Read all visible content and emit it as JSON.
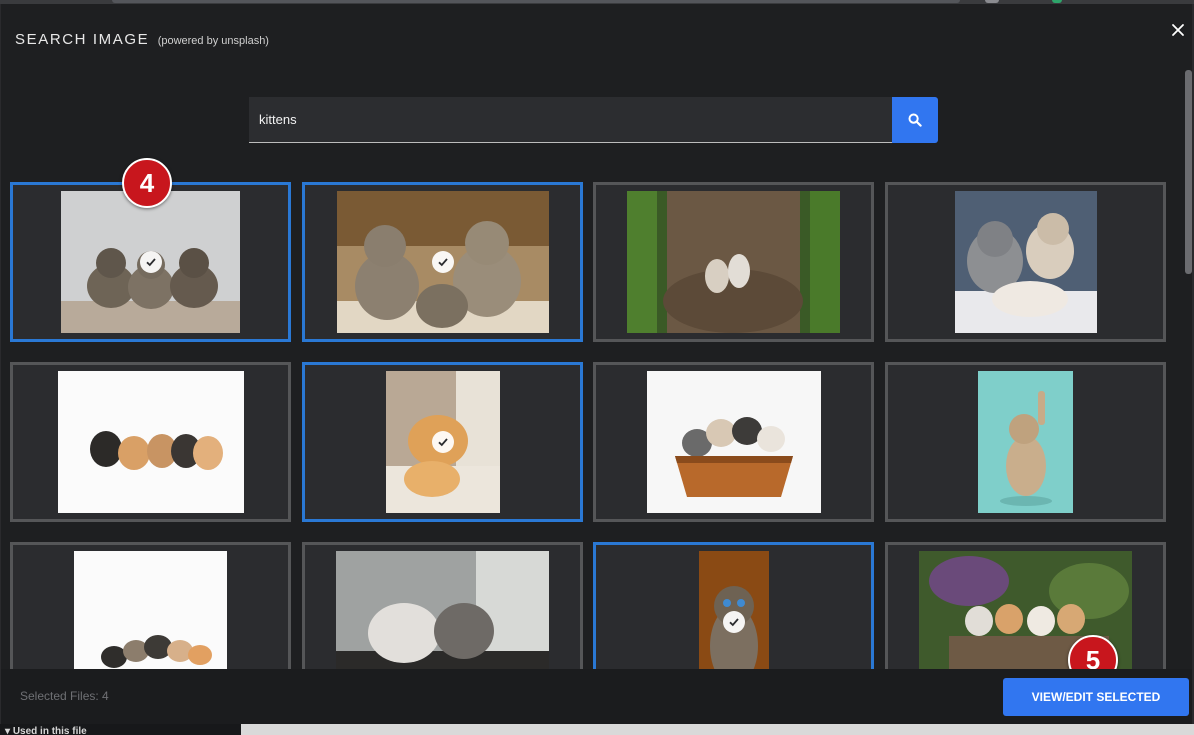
{
  "dialog": {
    "title": "SEARCH IMAGE",
    "subtitle": "(powered by unsplash)",
    "close_icon": "close-icon"
  },
  "search": {
    "value": "kittens",
    "icon": "search-icon"
  },
  "results": [
    {
      "subject": "three tabby kittens on grey background",
      "selected": true
    },
    {
      "subject": "four tabby kittens sitting together",
      "selected": true
    },
    {
      "subject": "two kittens walking on forest path",
      "selected": false
    },
    {
      "subject": "grey and white kittens on blanket",
      "selected": false
    },
    {
      "subject": "row of kittens on white background",
      "selected": false
    },
    {
      "subject": "orange kitten sleeping on couch",
      "selected": true
    },
    {
      "subject": "kittens in wicker basket",
      "selected": false
    },
    {
      "subject": "kitten reaching up on teal background",
      "selected": false
    },
    {
      "subject": "group of kittens on white background",
      "selected": false
    },
    {
      "subject": "two fluffy kittens by window",
      "selected": false
    },
    {
      "subject": "tabby kitten portrait",
      "selected": true
    },
    {
      "subject": "kittens in basket under lilacs",
      "selected": false
    }
  ],
  "annotations": [
    "4",
    "5"
  ],
  "footer": {
    "selected_files": "Selected Files: 4",
    "view_edit_label": "VIEW/EDIT SELECTED"
  },
  "side_panel": {
    "section_label": "Used in this file"
  },
  "colors": {
    "accent": "#3176f0",
    "selected_border": "#2a78d4",
    "badge": "#c8161d"
  }
}
